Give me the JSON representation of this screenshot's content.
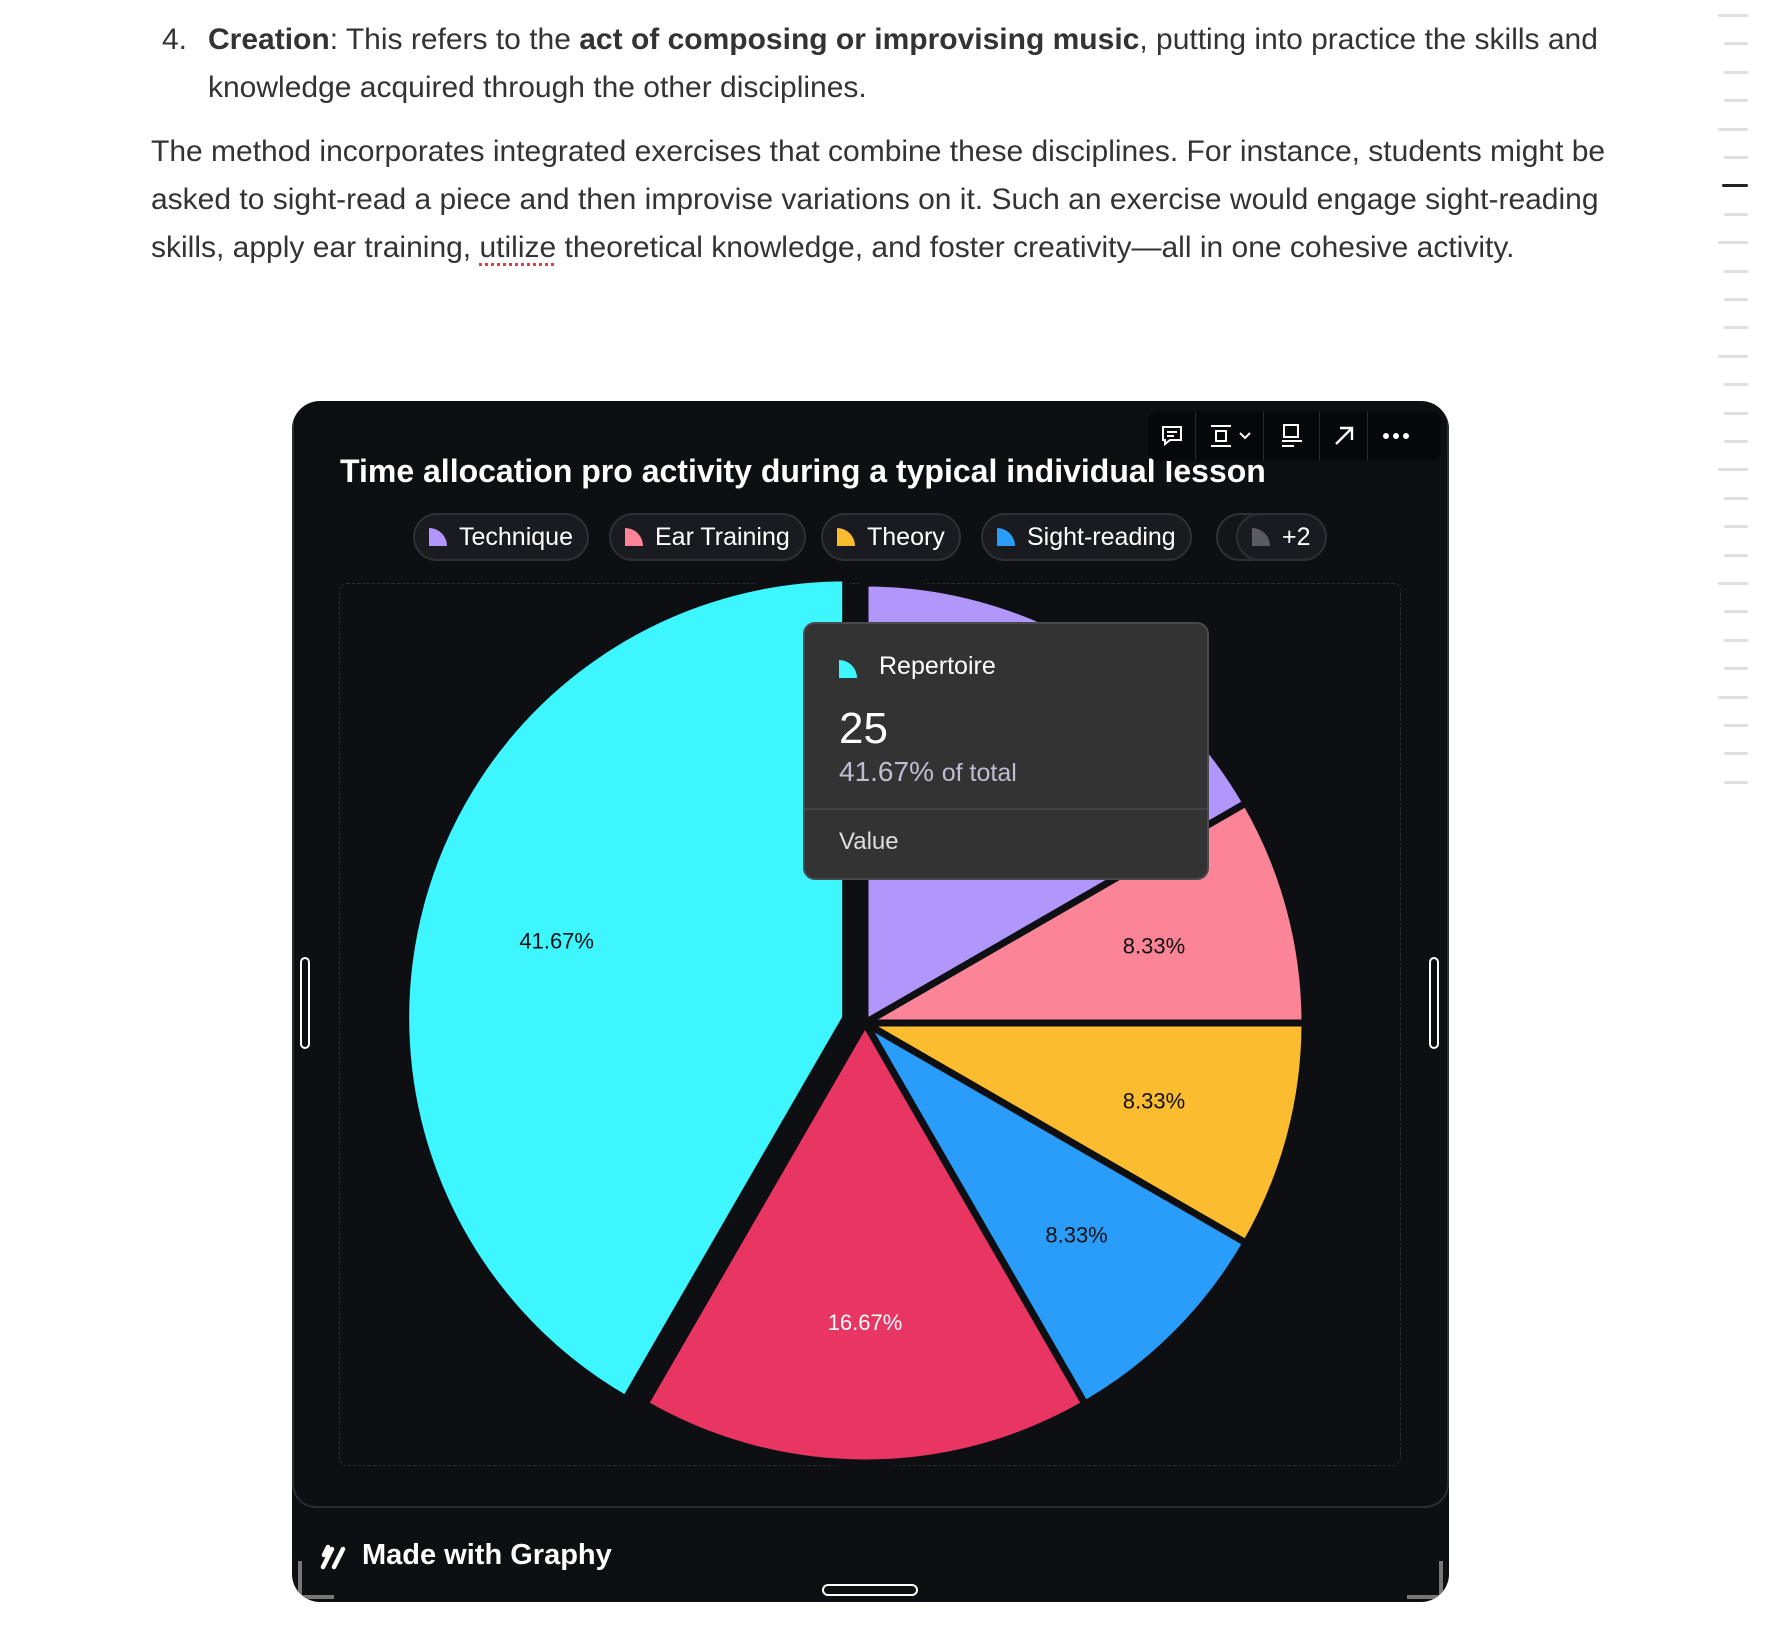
{
  "document": {
    "list_item": {
      "number": "4.",
      "term": "Creation",
      "text_before": ": This refers to the ",
      "bold_phrase": "act of composing or improvising music",
      "text_after": ", putting into practice the skills and knowledge acquired through the other disciplines."
    },
    "paragraph": {
      "before": "The method incorporates integrated exercises that combine these disciplines. For instance, students might be asked to sight-read a piece and then improvise variations on it. Such an exercise would engage sight-reading skills, apply ear training, ",
      "misspelled": "utilize",
      "after": " theoretical knowledge, and foster creativity—all in one cohesive activity."
    }
  },
  "toolbar": {
    "icons": [
      "comment-icon",
      "align-icon",
      "chevron-down-icon",
      "caption-icon",
      "open-external-icon",
      "more-icon"
    ]
  },
  "legend": {
    "items": [
      {
        "label": "Technique",
        "color": "#b197fc"
      },
      {
        "label": "Ear Training",
        "color": "#fb8597"
      },
      {
        "label": "Theory",
        "color": "#fbbc30"
      },
      {
        "label": "Sight-reading",
        "color": "#2a9dfb"
      }
    ],
    "more": "+2"
  },
  "chart_data": {
    "type": "pie",
    "title": "Time allocation pro activity during a typical individual lesson",
    "slices": [
      {
        "name": "Technique",
        "value": 10,
        "percent": "16.67%",
        "color": "#b197fc",
        "label_visible": false
      },
      {
        "name": "Ear Training",
        "value": 5,
        "percent": "8.33%",
        "color": "#fb8597",
        "label_visible": true
      },
      {
        "name": "Theory",
        "value": 5,
        "percent": "8.33%",
        "color": "#fbbc30",
        "label_visible": true
      },
      {
        "name": "Sight-reading",
        "value": 5,
        "percent": "8.33%",
        "color": "#2a9dfb",
        "label_visible": true
      },
      {
        "name": "",
        "value": 10,
        "percent": "16.67%",
        "color": "#e83562",
        "label_visible": true,
        "label_color": "#ffffff"
      },
      {
        "name": "Repertoire",
        "value": 25,
        "percent": "41.67%",
        "color": "#3ef6ff",
        "label_visible": true,
        "highlighted": true
      }
    ]
  },
  "tooltip": {
    "name": "Repertoire",
    "value": "25",
    "percent": "41.67%",
    "of_total": "of total",
    "metric": "Value"
  },
  "footer": {
    "label": "Made with Graphy"
  }
}
